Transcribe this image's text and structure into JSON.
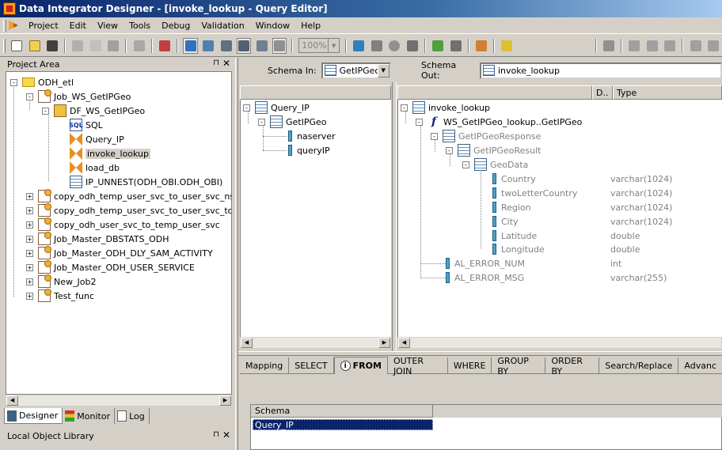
{
  "window": {
    "title": "Data Integrator Designer - [invoke_lookup - Query Editor]"
  },
  "menu": [
    "Project",
    "Edit",
    "View",
    "Tools",
    "Debug",
    "Validation",
    "Window",
    "Help"
  ],
  "toolbar": {
    "zoom": "100%"
  },
  "project_area": {
    "title": "Project Area",
    "pin": "⊓",
    "close": "✕",
    "tree": [
      {
        "label": "ODH_etl",
        "icon": "folder-icon",
        "expander": "-"
      },
      {
        "label": "Job_WS_GetIPGeo",
        "icon": "job-icon",
        "expander": "-"
      },
      {
        "label": "DF_WS_GetIPGeo",
        "icon": "dataflow-icon",
        "expander": "-"
      },
      {
        "label": "SQL",
        "icon": "sql-icon",
        "icon_text": "SQL"
      },
      {
        "label": "Query_IP",
        "icon": "query-icon"
      },
      {
        "label": "invoke_lookup",
        "icon": "query-icon"
      },
      {
        "label": "load_db",
        "icon": "query-icon"
      },
      {
        "label": "IP_UNNEST(ODH_OBI.ODH_OBI)",
        "icon": "table-icon"
      },
      {
        "label": "copy_odh_temp_user_svc_to_user_svc_nscr",
        "icon": "job-icon",
        "expander": "+"
      },
      {
        "label": "copy_odh_temp_user_svc_to_user_svc_toon",
        "icon": "job-icon",
        "expander": "+"
      },
      {
        "label": "copy_odh_user_svc_to_temp_user_svc",
        "icon": "job-icon",
        "expander": "+"
      },
      {
        "label": "Job_Master_DBSTATS_ODH",
        "icon": "job-icon",
        "expander": "+"
      },
      {
        "label": "Job_Master_ODH_DLY_SAM_ACTIVITY",
        "icon": "job-icon",
        "expander": "+"
      },
      {
        "label": "Job_Master_ODH_USER_SERVICE",
        "icon": "job-icon",
        "expander": "+"
      },
      {
        "label": "New_Job2",
        "icon": "job-icon",
        "expander": "+"
      },
      {
        "label": "Test_func",
        "icon": "job-icon",
        "expander": "+"
      }
    ],
    "tabs": [
      "Designer",
      "Monitor",
      "Log"
    ]
  },
  "local_library": {
    "title": "Local Object Library"
  },
  "schema_in": {
    "label": "Schema In:",
    "selected": "GetIPGeo",
    "tree": [
      {
        "label": "Query_IP",
        "expander": "-"
      },
      {
        "label": "GetIPGeo",
        "expander": "-"
      },
      {
        "label": "naserver"
      },
      {
        "label": "queryIP"
      }
    ]
  },
  "schema_out": {
    "label": "Schema Out:",
    "value": "invoke_lookup",
    "columns": [
      "D..",
      "Type"
    ],
    "tree": [
      {
        "label": "invoke_lookup",
        "type": "",
        "expander": "-"
      },
      {
        "label": "WS_GetIPGeo_lookup..GetIPGeo",
        "type": "",
        "expander": "-"
      },
      {
        "label": "GetIPGeoResponse",
        "type": "",
        "expander": "-"
      },
      {
        "label": "GetIPGeoResult",
        "type": "",
        "expander": "-"
      },
      {
        "label": "GeoData",
        "type": "",
        "expander": "-"
      },
      {
        "label": "Country",
        "type": "varchar(1024)"
      },
      {
        "label": "twoLetterCountry",
        "type": "varchar(1024)"
      },
      {
        "label": "Region",
        "type": "varchar(1024)"
      },
      {
        "label": "City",
        "type": "varchar(1024)"
      },
      {
        "label": "Latitude",
        "type": "double"
      },
      {
        "label": "Longitude",
        "type": "double"
      },
      {
        "label": "AL_ERROR_NUM",
        "type": "int"
      },
      {
        "label": "AL_ERROR_MSG",
        "type": "varchar(255)"
      }
    ]
  },
  "bottom_tabs": [
    "Mapping",
    "SELECT",
    "FROM",
    "OUTER JOIN",
    "WHERE",
    "GROUP BY",
    "ORDER BY",
    "Search/Replace",
    "Advanc"
  ],
  "active_bottom_tab": "FROM",
  "from_grid": {
    "header": "Schema",
    "selected_row": "Query_IP"
  },
  "colors": {
    "title_bar": "#0a246a",
    "selection": "#0a246a",
    "panel": "#d4d0c8"
  }
}
